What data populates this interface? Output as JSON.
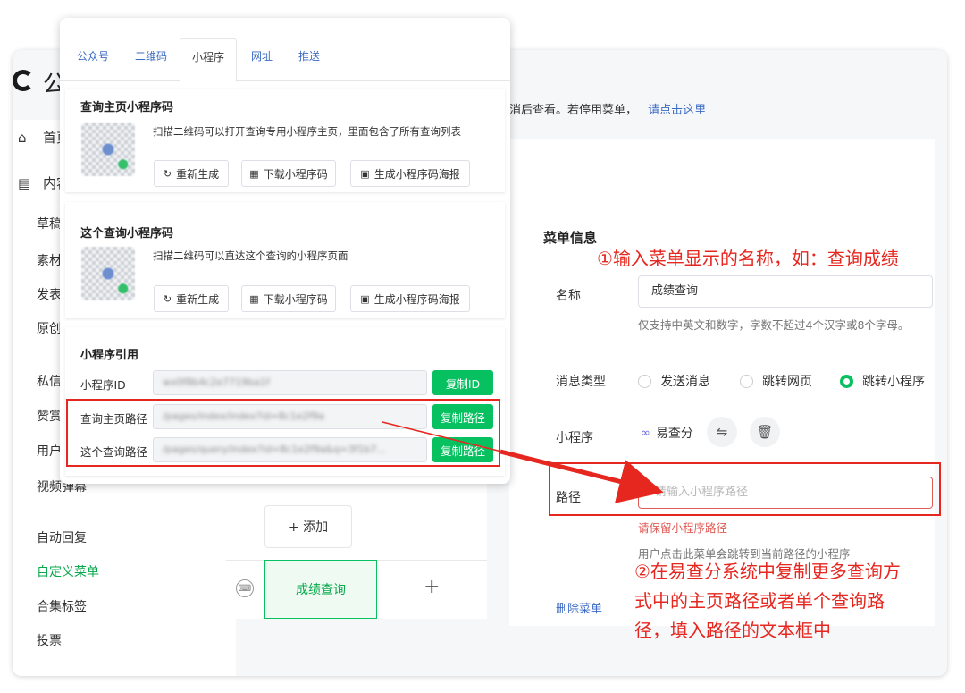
{
  "brand": {
    "text": "公"
  },
  "sidebar": {
    "top_items": [
      {
        "label": "首页",
        "icon": "home-icon"
      },
      {
        "label": "内容",
        "icon": "document-icon"
      }
    ],
    "sub_items": [
      "草稿",
      "素材",
      "发表",
      "原创",
      "私信",
      "赞赏",
      "用户",
      "视频弹幕",
      "自动回复",
      "自定义菜单",
      "合集标签",
      "投票"
    ]
  },
  "notice": {
    "text": "消后查看。若停用菜单，",
    "link": "请点击这里"
  },
  "preview": {
    "add_label": "+ 添加",
    "active_menu": "成绩查询",
    "plus": "+"
  },
  "form": {
    "title": "菜单信息",
    "name_label": "名称",
    "name_value": "成绩查询",
    "name_hint": "仅支持中英文和数字，字数不超过4个汉字或8个字母。",
    "msg_type_label": "消息类型",
    "msg_types": [
      {
        "label": "发送消息",
        "selected": false
      },
      {
        "label": "跳转网页",
        "selected": false
      },
      {
        "label": "跳转小程序",
        "selected": true
      }
    ],
    "mini_program_label": "小程序",
    "mini_program_name": "易查分",
    "path_label": "路径",
    "path_placeholder": "请输入小程序路径",
    "path_error": "请保留小程序路径",
    "path_hint": "用户点击此菜单会跳转到当前路径的小程序",
    "delete_label": "删除菜单"
  },
  "annotations": {
    "a1": "①输入菜单显示的名称，如：查询成绩",
    "a2_lines": [
      "②在易查分系统中复制更多查询方",
      "式中的主页路径或者单个查询路",
      "径，填入路径的文本框中"
    ],
    "color": "#e6271f"
  },
  "popup": {
    "tabs": [
      "公众号",
      "二维码",
      "小程序",
      "网址",
      "推送"
    ],
    "active_tab": "小程序",
    "home_code": {
      "title": "查询主页小程序码",
      "desc": "扫描二维码可以打开查询专用小程序主页，里面包含了所有查询列表",
      "buttons": [
        "重新生成",
        "下载小程序码",
        "生成小程序码海报"
      ]
    },
    "query_code": {
      "title": "这个查询小程序码",
      "desc": "扫描二维码可以直达这个查询的小程序页面",
      "buttons": [
        "重新生成",
        "下载小程序码",
        "生成小程序码海报"
      ]
    },
    "reference": {
      "title": "小程序引用",
      "rows": [
        {
          "label": "小程序ID",
          "value": "wx0f8b4c2e7719ba1f",
          "button": "复制ID"
        },
        {
          "label": "查询主页路径",
          "value": "/pages/index/index?id=8c1e2f9a",
          "button": "复制路径"
        },
        {
          "label": "这个查询路径",
          "value": "/pages/query/index?id=8c1e2f9a&q=3f1b7...",
          "button": "复制路径"
        }
      ]
    }
  },
  "colors": {
    "green": "#07c160",
    "link": "#3c6bc3",
    "red": "#e6271f"
  }
}
